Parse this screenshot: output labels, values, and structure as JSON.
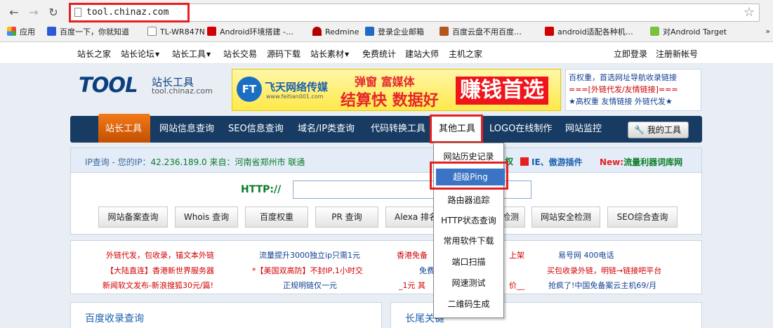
{
  "browser": {
    "url": "tool.chinaz.com",
    "bookmarks": [
      "应用",
      "百度一下，你就知道",
      "TL-WR847N",
      "Android环境搭建 -…",
      "Redmine",
      "登录企业邮箱",
      "百度云盘不用百度…",
      "android适配各种机…",
      "对Android Target"
    ],
    "bookmarks_more": "»"
  },
  "topnav": {
    "links": [
      "站长之家",
      "站长论坛",
      "站长工具",
      "站长交易",
      "源码下载",
      "站长素材",
      "免费统计",
      "建站大师",
      "主机之家"
    ],
    "login": "立即登录",
    "register": "注册新帐号"
  },
  "logo": {
    "main": "TOOL",
    "cn": "站长工具",
    "en": "tool.chinaz.com"
  },
  "banner": {
    "ft": "FT",
    "brand": "飞天网络传媒",
    "site": "www.feitian001.com",
    "line1": "弹窗 富媒体",
    "line2": "结算快 数据好",
    "line3": "赚钱首选"
  },
  "promo": {
    "line1": "百权重，首选网址导航收录链接",
    "line2": "===[外链代发/友情链接]===",
    "line3": "★高权重 友情链接 外链代发★"
  },
  "mainnav": {
    "items": [
      "站长工具",
      "网站信息查询",
      "SEO信息查询",
      "域名/IP类查询",
      "代码转换工具",
      "其他工具",
      "LOGO在线制作",
      "网站监控"
    ],
    "my_tools": "我的工具"
  },
  "ipbar": {
    "prefix": "IP查询 - 您的IP：",
    "ip": "42.236.189.0",
    "from": " 来自：河南省郑州市 联通",
    "ie_link": "IE、傲游插件",
    "new_label": "New:",
    "new_link": "流量利器词库网"
  },
  "search": {
    "label": "HTTP://",
    "buttons": [
      "网站备案查询",
      "Whois 查询",
      "百度权重",
      "PR 查询",
      "Alexa 排名",
      "检测",
      "网站安全检测",
      "SEO综合查询"
    ]
  },
  "dropdown": {
    "items": [
      "网站历史记录",
      "超级Ping",
      "路由器追踪",
      "HTTP状态查询",
      "常用软件下载",
      "端口扫描",
      "网速测试",
      "二维码生成"
    ],
    "selected": "超级Ping",
    "extra": "权"
  },
  "ads": {
    "col1": [
      "外链代发，包收录，锚文本外链",
      "【大陆直连】香港新世界服务器",
      "新闻软文发布-新浪搜狐30元/篇!"
    ],
    "col2": [
      "流量提升3000独立ip只需1元",
      "*【美国双高防】不封IP,1小时交",
      "正规明链仅一元"
    ],
    "col3": [
      "香港免备",
      "免费",
      "_1元 其"
    ],
    "col3b": [
      "上架",
      "价__"
    ],
    "col4": [
      "易号网 400电话",
      "买包收录外链，明链→链接吧平台",
      "抢疯了!中国免备案云主机69/月"
    ]
  },
  "panels": {
    "left": "百度收录查询",
    "right": "长尾关键"
  }
}
